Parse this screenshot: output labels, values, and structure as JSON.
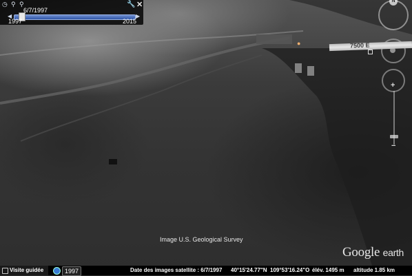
{
  "time_slider": {
    "current_date": "6/7/1997",
    "start_year": "1997",
    "end_year": "2015",
    "position": 0.0
  },
  "map": {
    "road_label": "7500 E",
    "imagery_credit": "Image U.S. Geological Survey",
    "logo_google": "Google",
    "logo_earth": "earth",
    "compass_letter": "N"
  },
  "status_bar": {
    "tour_label": "Visite guidée",
    "history_year": "1997",
    "imagery_date": "Date des images satellite : 6/7/1997",
    "latitude": "40°15'24.77\"N",
    "longitude": "109°53'16.24\"O",
    "elevation": "élév. 1495 m",
    "altitude": "altitude   1.85 km"
  },
  "icons": [
    "clock-icon",
    "zoom-out-icon",
    "zoom-in-icon",
    "wrench-icon",
    "close-icon",
    "compass-icon",
    "place-pin-icon",
    "tour-icon",
    "history-icon"
  ]
}
